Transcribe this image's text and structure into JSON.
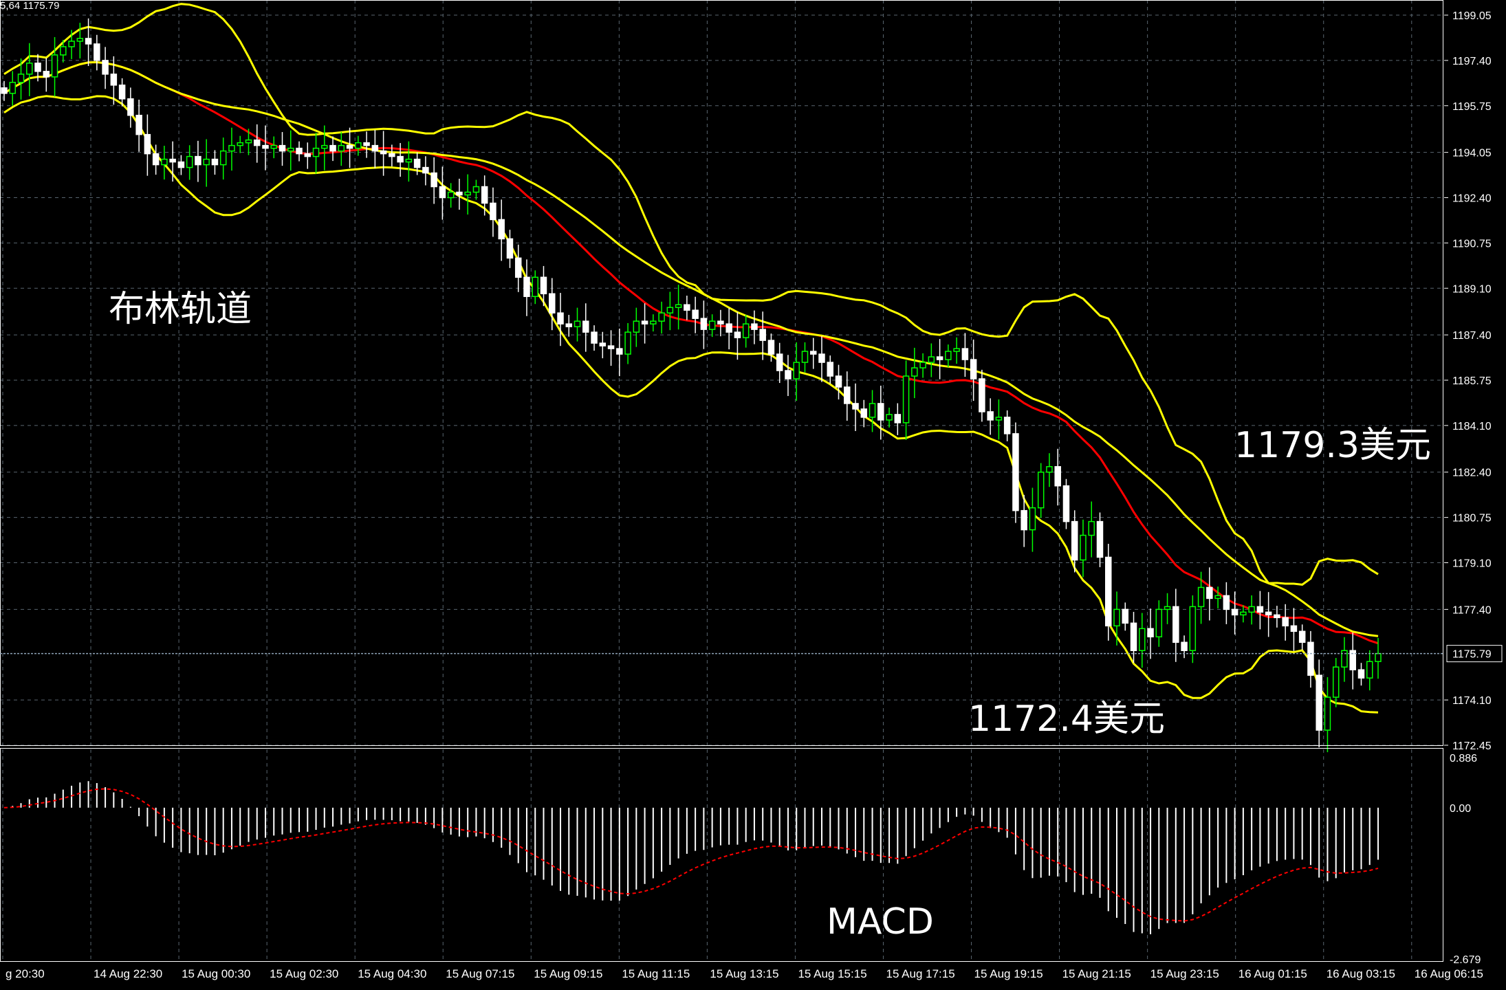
{
  "chart_data": [
    {
      "type": "candlestick",
      "instrument_info": "5,64 1175.79",
      "price_ticks": [
        "1199.05",
        "1197.40",
        "1195.75",
        "1194.05",
        "1192.40",
        "1190.75",
        "1189.10",
        "1187.40",
        "1185.75",
        "1184.10",
        "1182.40",
        "1180.75",
        "1179.10",
        "1177.40",
        "1174.10",
        "1172.45"
      ],
      "ylim": [
        1172.45,
        1199.05
      ],
      "current_price": "1175.79",
      "time_labels": [
        "g 20:30",
        "14 Aug 22:30",
        "15 Aug 00:30",
        "15 Aug 02:30",
        "15 Aug 04:30",
        "15 Aug 07:15",
        "15 Aug 09:15",
        "15 Aug 11:15",
        "15 Aug 13:15",
        "15 Aug 15:15",
        "15 Aug 17:15",
        "15 Aug 19:15",
        "15 Aug 21:15",
        "15 Aug 23:15",
        "16 Aug 01:15",
        "16 Aug 03:15",
        "16 Aug 06:15"
      ],
      "grid": true,
      "bars_close": [
        1196.2,
        1196.6,
        1196.9,
        1197.3,
        1197.0,
        1196.8,
        1197.6,
        1197.9,
        1198.1,
        1198.2,
        1198.0,
        1197.4,
        1196.9,
        1196.5,
        1196.0,
        1195.4,
        1194.7,
        1194.0,
        1193.6,
        1193.8,
        1193.7,
        1193.5,
        1193.9,
        1193.6,
        1193.8,
        1193.6,
        1194.1,
        1194.3,
        1194.4,
        1194.5,
        1194.3,
        1194.2,
        1194.3,
        1194.1,
        1194.2,
        1194.0,
        1193.9,
        1194.2,
        1194.3,
        1194.1,
        1194.3,
        1194.2,
        1194.4,
        1194.3,
        1194.1,
        1194.0,
        1193.9,
        1193.7,
        1193.8,
        1193.5,
        1193.3,
        1192.8,
        1192.4,
        1192.6,
        1192.5,
        1192.6,
        1192.8,
        1192.2,
        1191.6,
        1190.9,
        1190.2,
        1189.5,
        1188.8,
        1189.5,
        1188.9,
        1188.2,
        1187.8,
        1187.7,
        1187.9,
        1187.5,
        1187.1,
        1187.0,
        1186.9,
        1186.7,
        1187.5,
        1187.9,
        1187.8,
        1187.9,
        1188.2,
        1188.4,
        1188.5,
        1188.3,
        1188.0,
        1187.6,
        1187.9,
        1187.8,
        1187.5,
        1187.3,
        1187.8,
        1187.6,
        1187.2,
        1186.7,
        1186.1,
        1185.8,
        1186.4,
        1186.8,
        1186.7,
        1186.4,
        1185.9,
        1185.5,
        1184.9,
        1184.7,
        1184.4,
        1184.9,
        1184.3,
        1184.5,
        1184.2,
        1185.9,
        1186.2,
        1186.4,
        1186.6,
        1186.5,
        1186.8,
        1186.9,
        1186.5,
        1185.8,
        1184.6,
        1184.3,
        1184.4,
        1183.8,
        1181.0,
        1180.3,
        1181.1,
        1182.4,
        1182.6,
        1181.9,
        1180.6,
        1179.2,
        1180.1,
        1180.6,
        1179.3,
        1176.8,
        1177.4,
        1176.9,
        1175.9,
        1176.7,
        1176.4,
        1177.4,
        1177.5,
        1176.2,
        1175.9,
        1177.5,
        1178.2,
        1177.8,
        1177.9,
        1177.4,
        1177.2,
        1177.3,
        1177.5,
        1177.3,
        1177.2,
        1177.1,
        1176.8,
        1176.6,
        1176.2,
        1175.0,
        1173.0,
        1174.2,
        1175.3,
        1175.9,
        1175.2,
        1174.9,
        1175.5,
        1175.79
      ],
      "indicators": [
        {
          "name": "bollinger_upper",
          "color": "#ffff00"
        },
        {
          "name": "bollinger_middle",
          "color": "#ff0000"
        },
        {
          "name": "bollinger_lower",
          "color": "#ffff00"
        },
        {
          "name": "sma",
          "color": "#ffff00"
        }
      ]
    },
    {
      "type": "bar",
      "macd_ticks": [
        "0.886",
        "0.00",
        "-2.679"
      ],
      "ylim": [
        -2.679,
        0.886
      ],
      "histogram_color": "#ffffff",
      "signal_color": "#ff0000"
    }
  ],
  "annotations": {
    "bollinger": "布林轨道",
    "upper_price": "1179.3美元",
    "lower_price": "1172.4美元",
    "macd": "MACD"
  },
  "colors": {
    "background": "#000000",
    "grid": "#5a6670",
    "axis_text": "#ffffff",
    "bull_candle": "#00ff00",
    "bear_candle": "#ffffff",
    "price_line": "#8ea4b8"
  }
}
